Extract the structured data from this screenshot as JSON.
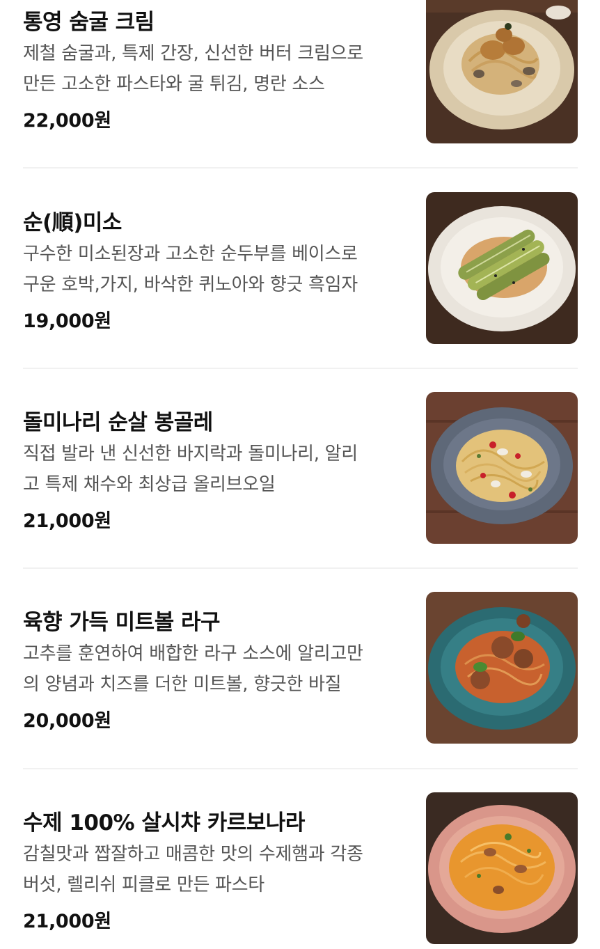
{
  "menu": {
    "items": [
      {
        "name": "통영 숨굴 크림",
        "desc_lines": [
          "제철 숨굴과, 특제 간장, 신선한 버터 크림으로",
          "만든 고소한 파스타와 굴 튀김, 명란 소스"
        ],
        "price": "22,000원",
        "photo_icon": "oyster-cream-pasta-photo"
      },
      {
        "name": "순(順)미소",
        "desc_lines": [
          "구수한 미소된장과 고소한 순두부를 베이스로",
          "구운 호박,가지, 바삭한 퀴노아와 향긋 흑임자"
        ],
        "price": "19,000원",
        "photo_icon": "miso-zucchini-pasta-photo"
      },
      {
        "name": "돌미나리 순살 봉골레",
        "desc_lines": [
          "직접 발라 낸 신선한 바지락과 돌미나리, 알리",
          "고 특제 채수와 최상급 올리브오일"
        ],
        "price": "21,000원",
        "photo_icon": "vongole-pasta-photo"
      },
      {
        "name": "육향 가득 미트볼 라구",
        "desc_lines": [
          "고추를 훈연하여 배합한 라구 소스에 알리고만",
          "의 양념과 치즈를 더한 미트볼, 향긋한 바질"
        ],
        "price": "20,000원",
        "photo_icon": "meatball-ragu-pasta-photo"
      },
      {
        "name": "수제 100% 살시챠 카르보나라",
        "desc_lines": [
          "감칠맛과 짭잘하고 매콤한 맛의 수제햄과 각종",
          "버섯, 렐리쉬 피클로 만든 파스타"
        ],
        "price": "21,000원",
        "photo_icon": "salsiccia-carbonara-photo"
      }
    ]
  }
}
